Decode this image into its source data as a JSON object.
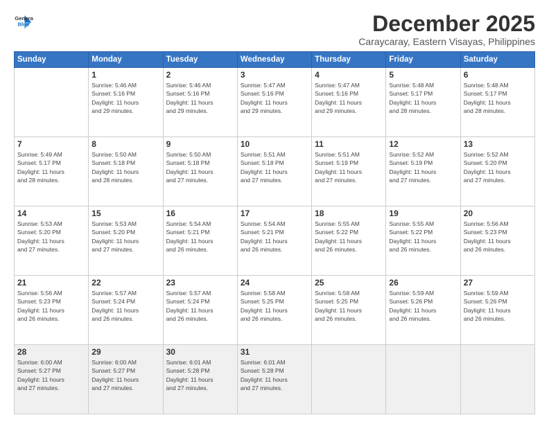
{
  "header": {
    "logo_line1": "General",
    "logo_line2": "Blue",
    "month": "December 2025",
    "location": "Caraycaray, Eastern Visayas, Philippines"
  },
  "weekdays": [
    "Sunday",
    "Monday",
    "Tuesday",
    "Wednesday",
    "Thursday",
    "Friday",
    "Saturday"
  ],
  "weeks": [
    [
      {
        "day": "",
        "info": ""
      },
      {
        "day": "1",
        "info": "Sunrise: 5:46 AM\nSunset: 5:16 PM\nDaylight: 11 hours\nand 29 minutes."
      },
      {
        "day": "2",
        "info": "Sunrise: 5:46 AM\nSunset: 5:16 PM\nDaylight: 11 hours\nand 29 minutes."
      },
      {
        "day": "3",
        "info": "Sunrise: 5:47 AM\nSunset: 5:16 PM\nDaylight: 11 hours\nand 29 minutes."
      },
      {
        "day": "4",
        "info": "Sunrise: 5:47 AM\nSunset: 5:16 PM\nDaylight: 11 hours\nand 29 minutes."
      },
      {
        "day": "5",
        "info": "Sunrise: 5:48 AM\nSunset: 5:17 PM\nDaylight: 11 hours\nand 28 minutes."
      },
      {
        "day": "6",
        "info": "Sunrise: 5:48 AM\nSunset: 5:17 PM\nDaylight: 11 hours\nand 28 minutes."
      }
    ],
    [
      {
        "day": "7",
        "info": "Sunrise: 5:49 AM\nSunset: 5:17 PM\nDaylight: 11 hours\nand 28 minutes."
      },
      {
        "day": "8",
        "info": "Sunrise: 5:50 AM\nSunset: 5:18 PM\nDaylight: 11 hours\nand 28 minutes."
      },
      {
        "day": "9",
        "info": "Sunrise: 5:50 AM\nSunset: 5:18 PM\nDaylight: 11 hours\nand 27 minutes."
      },
      {
        "day": "10",
        "info": "Sunrise: 5:51 AM\nSunset: 5:18 PM\nDaylight: 11 hours\nand 27 minutes."
      },
      {
        "day": "11",
        "info": "Sunrise: 5:51 AM\nSunset: 5:19 PM\nDaylight: 11 hours\nand 27 minutes."
      },
      {
        "day": "12",
        "info": "Sunrise: 5:52 AM\nSunset: 5:19 PM\nDaylight: 11 hours\nand 27 minutes."
      },
      {
        "day": "13",
        "info": "Sunrise: 5:52 AM\nSunset: 5:20 PM\nDaylight: 11 hours\nand 27 minutes."
      }
    ],
    [
      {
        "day": "14",
        "info": "Sunrise: 5:53 AM\nSunset: 5:20 PM\nDaylight: 11 hours\nand 27 minutes."
      },
      {
        "day": "15",
        "info": "Sunrise: 5:53 AM\nSunset: 5:20 PM\nDaylight: 11 hours\nand 27 minutes."
      },
      {
        "day": "16",
        "info": "Sunrise: 5:54 AM\nSunset: 5:21 PM\nDaylight: 11 hours\nand 26 minutes."
      },
      {
        "day": "17",
        "info": "Sunrise: 5:54 AM\nSunset: 5:21 PM\nDaylight: 11 hours\nand 26 minutes."
      },
      {
        "day": "18",
        "info": "Sunrise: 5:55 AM\nSunset: 5:22 PM\nDaylight: 11 hours\nand 26 minutes."
      },
      {
        "day": "19",
        "info": "Sunrise: 5:55 AM\nSunset: 5:22 PM\nDaylight: 11 hours\nand 26 minutes."
      },
      {
        "day": "20",
        "info": "Sunrise: 5:56 AM\nSunset: 5:23 PM\nDaylight: 11 hours\nand 26 minutes."
      }
    ],
    [
      {
        "day": "21",
        "info": "Sunrise: 5:56 AM\nSunset: 5:23 PM\nDaylight: 11 hours\nand 26 minutes."
      },
      {
        "day": "22",
        "info": "Sunrise: 5:57 AM\nSunset: 5:24 PM\nDaylight: 11 hours\nand 26 minutes."
      },
      {
        "day": "23",
        "info": "Sunrise: 5:57 AM\nSunset: 5:24 PM\nDaylight: 11 hours\nand 26 minutes."
      },
      {
        "day": "24",
        "info": "Sunrise: 5:58 AM\nSunset: 5:25 PM\nDaylight: 11 hours\nand 26 minutes."
      },
      {
        "day": "25",
        "info": "Sunrise: 5:58 AM\nSunset: 5:25 PM\nDaylight: 11 hours\nand 26 minutes."
      },
      {
        "day": "26",
        "info": "Sunrise: 5:59 AM\nSunset: 5:26 PM\nDaylight: 11 hours\nand 26 minutes."
      },
      {
        "day": "27",
        "info": "Sunrise: 5:59 AM\nSunset: 5:26 PM\nDaylight: 11 hours\nand 26 minutes."
      }
    ],
    [
      {
        "day": "28",
        "info": "Sunrise: 6:00 AM\nSunset: 5:27 PM\nDaylight: 11 hours\nand 27 minutes."
      },
      {
        "day": "29",
        "info": "Sunrise: 6:00 AM\nSunset: 5:27 PM\nDaylight: 11 hours\nand 27 minutes."
      },
      {
        "day": "30",
        "info": "Sunrise: 6:01 AM\nSunset: 5:28 PM\nDaylight: 11 hours\nand 27 minutes."
      },
      {
        "day": "31",
        "info": "Sunrise: 6:01 AM\nSunset: 5:28 PM\nDaylight: 11 hours\nand 27 minutes."
      },
      {
        "day": "",
        "info": ""
      },
      {
        "day": "",
        "info": ""
      },
      {
        "day": "",
        "info": ""
      }
    ]
  ]
}
